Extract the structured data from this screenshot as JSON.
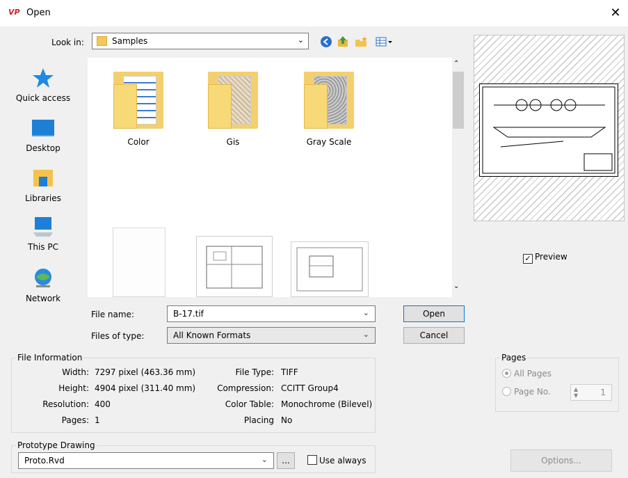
{
  "window": {
    "title": "Open",
    "logo_text": "VP",
    "close_glyph": "✕"
  },
  "lookin": {
    "label": "Look in:",
    "value": "Samples",
    "icons": [
      "back-icon",
      "up-folder-icon",
      "new-folder-icon",
      "view-menu-icon"
    ]
  },
  "sidebar": {
    "items": [
      {
        "label": "Quick access",
        "icon": "quick-access-icon"
      },
      {
        "label": "Desktop",
        "icon": "desktop-icon"
      },
      {
        "label": "Libraries",
        "icon": "libraries-icon"
      },
      {
        "label": "This PC",
        "icon": "this-pc-icon"
      },
      {
        "label": "Network",
        "icon": "network-icon"
      }
    ]
  },
  "files": {
    "items": [
      {
        "label": "Color",
        "type": "folder"
      },
      {
        "label": "Gis",
        "type": "folder"
      },
      {
        "label": "Gray Scale",
        "type": "folder"
      }
    ]
  },
  "filename": {
    "label": "File name:",
    "value": "B-17.tif"
  },
  "filetype": {
    "label": "Files of type:",
    "value": "All Known Formats"
  },
  "buttons": {
    "open": "Open",
    "cancel": "Cancel",
    "options": "Options...",
    "browse": "..."
  },
  "preview": {
    "label": "Preview",
    "checked": true
  },
  "file_info": {
    "title": "File Information",
    "rows_left": [
      {
        "label": "Width:",
        "value": "7297 pixel (463.36 mm)"
      },
      {
        "label": "Height:",
        "value": "4904 pixel (311.40 mm)"
      },
      {
        "label": "Resolution:",
        "value": "400"
      },
      {
        "label": "Pages:",
        "value": "1"
      }
    ],
    "rows_right": [
      {
        "label": "File Type:",
        "value": "TIFF"
      },
      {
        "label": "Compression:",
        "value": "CCITT Group4"
      },
      {
        "label": "Color Table:",
        "value": "Monochrome (Bilevel)"
      },
      {
        "label": "Placing",
        "value": "No"
      }
    ]
  },
  "pages": {
    "title": "Pages",
    "all_pages": "All Pages",
    "page_no": "Page No.",
    "page_value": "1"
  },
  "prototype": {
    "title": "Prototype Drawing",
    "value": "Proto.Rvd",
    "use_always": "Use always"
  }
}
